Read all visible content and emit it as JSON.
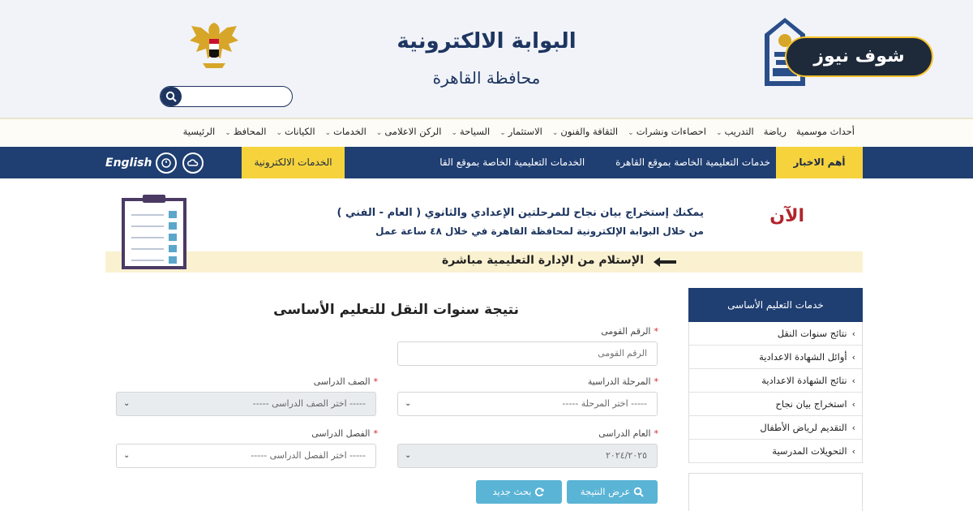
{
  "header": {
    "title": "البوابة الالكترونية",
    "subtitle": "محافظة القاهرة",
    "news_badge": "شوف نيوز"
  },
  "search": {
    "placeholder": "",
    "icon": "search-icon"
  },
  "nav": [
    {
      "label": "الرئيسية",
      "dropdown": false
    },
    {
      "label": "المحافظ",
      "dropdown": true
    },
    {
      "label": "الكيانات",
      "dropdown": true
    },
    {
      "label": "الخدمات",
      "dropdown": true
    },
    {
      "label": "الركن الاعلامى",
      "dropdown": true
    },
    {
      "label": "السياحة",
      "dropdown": true
    },
    {
      "label": "الاستثمار",
      "dropdown": true
    },
    {
      "label": "الثقافة والفنون",
      "dropdown": true
    },
    {
      "label": "احصاءات ونشرات",
      "dropdown": true
    },
    {
      "label": "التدريب",
      "dropdown": true
    },
    {
      "label": "رياضة",
      "dropdown": false
    },
    {
      "label": "أحداث موسمية",
      "dropdown": false
    }
  ],
  "topbar": {
    "news_label": "أهم الاخبار",
    "ticker": [
      "خدمات التعليمية الخاصة بموقع القاهرة",
      "الخدمات التعليمية الخاصة بموقع القا"
    ],
    "eservices": "الخدمات الالكترونية",
    "english": "English"
  },
  "banner": {
    "now": "الآن",
    "line1": "يمكنك إستخراج بيان نجاح للمرحلتين الإعدادي والثانوي ( العام - الفني )",
    "line2": "من خلال البوابة الإلكترونية لمحافظة القاهرة في خلال ٤٨ ساعة عمل",
    "receive": "الإستلام من الإدارة التعليمية مباشرة"
  },
  "sidebar": {
    "title": "خدمات التعليم الأساسى",
    "items": [
      "نتائج سنوات النقل",
      "أوائل الشهادة الاعدادية",
      "نتائج الشهادة الاعدادية",
      "استخراج بيان نجاح",
      "التقديم لرياض الأطفال",
      "التحويلات المدرسية"
    ]
  },
  "form": {
    "title": "نتيجة سنوات النقل للتعليم الأساسى",
    "national_id": {
      "label": "الرقم القومى",
      "placeholder": "الرقم القومى"
    },
    "stage": {
      "label": "المرحلة الدراسية",
      "value": "----- اختر المرحلة -----"
    },
    "grade": {
      "label": "الصف الدراسى",
      "value": "----- اختر الصف الدراسى -----"
    },
    "year": {
      "label": "العام الدراسى",
      "value": "٢٠٢٤/٢٠٢٥"
    },
    "term": {
      "label": "الفصل الدراسى",
      "value": "----- اختر الفصل الدراسى -----"
    },
    "show_button": "عرض النتيجة",
    "new_search_button": "بحث جديد"
  },
  "colors": {
    "navy": "#1f3e72",
    "yellow": "#f6d33c",
    "button": "#5ab4d5",
    "required": "#d8232a"
  }
}
